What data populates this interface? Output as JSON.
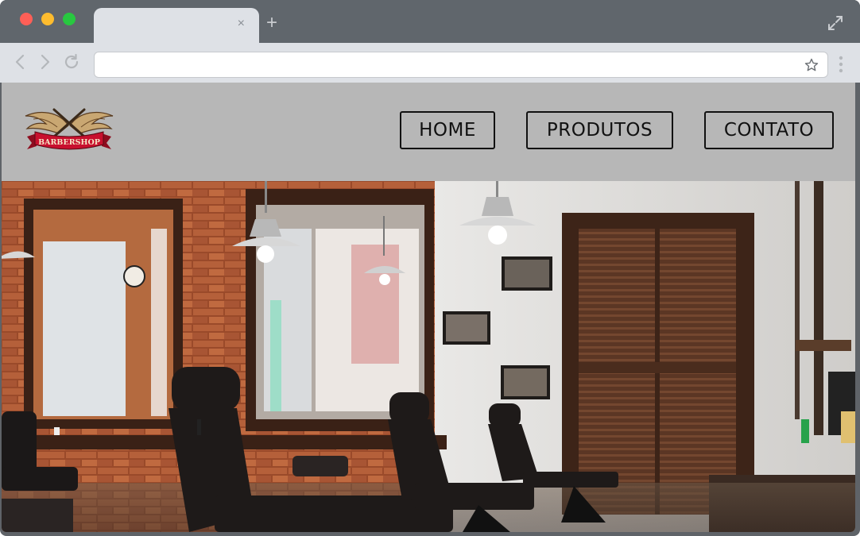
{
  "browser": {
    "tab_close": "×",
    "new_tab": "+",
    "address_url": ""
  },
  "site": {
    "logo_text": "BARBERSHOP",
    "nav": [
      {
        "label": "HOME"
      },
      {
        "label": "PRODUTOS"
      },
      {
        "label": "CONTATO"
      }
    ]
  },
  "colors": {
    "header_bg": "#b7b7b7",
    "nav_text": "#111111",
    "logo_ribbon": "#c8102e"
  }
}
